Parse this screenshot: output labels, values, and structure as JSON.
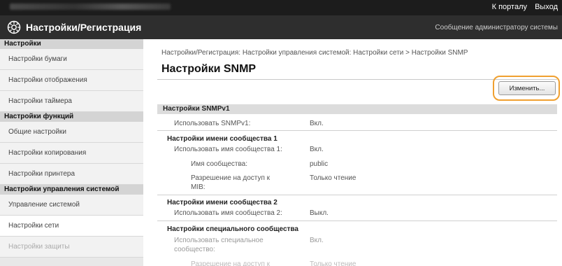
{
  "topbar": {
    "links": [
      "К порталу",
      "Выход"
    ]
  },
  "header": {
    "title": "Настройки/Регистрация",
    "admin_message": "Сообщение администратору системы"
  },
  "sidebar": {
    "sections": [
      {
        "heading": "Настройки",
        "items": [
          "Настройки бумаги",
          "Настройки отображения",
          "Настройки таймера"
        ]
      },
      {
        "heading": "Настройки функций",
        "items": [
          "Общие настройки",
          "Настройки копирования",
          "Настройки принтера"
        ]
      },
      {
        "heading": "Настройки управления системой",
        "items": [
          "Управление системой",
          "Настройки сети",
          "Настройки защиты"
        ]
      }
    ]
  },
  "main": {
    "breadcrumb": "Настройки/Регистрация: Настройки управления системой: Настройки сети > Настройки SNMP",
    "title": "Настройки SNMP",
    "edit_button": "Изменить...",
    "section_title": "Настройки SNMPv1",
    "use_snmpv1": {
      "label": "Использовать SNMPv1:",
      "value": "Вкл."
    },
    "community1": {
      "heading": "Настройки имени сообщества 1",
      "use_label": "Использовать имя сообщества 1:",
      "use_value": "Вкл.",
      "name_label": "Имя сообщества:",
      "name_value": "public",
      "access_label_line1": "Разрешение на доступ к",
      "access_label_line2": "MIB:",
      "access_value": "Только чтение"
    },
    "community2": {
      "heading": "Настройки имени сообщества 2",
      "use_label": "Использовать имя сообщества 2:",
      "use_value": "Выкл."
    },
    "special": {
      "heading": "Настройки специального сообщества",
      "use_label_line1": "Использовать специальное",
      "use_label_line2": "сообщество:",
      "use_value": "Вкл.",
      "access_label": "Разрешение на доступ к",
      "access_value": "Только чтение"
    }
  }
}
